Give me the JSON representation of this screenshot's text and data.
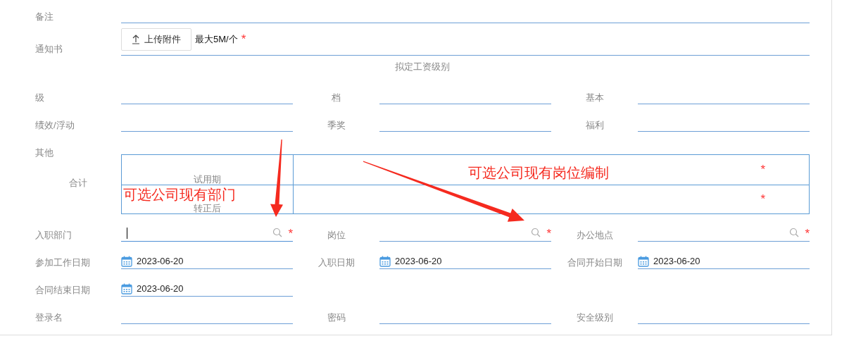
{
  "remark": {
    "label": "备注"
  },
  "notice": {
    "label": "通知书",
    "upload_button": "上传附件",
    "hint": "最大5M/个",
    "required_mark": "*"
  },
  "salary_section": {
    "title": "拟定工资级别",
    "rows": [
      [
        {
          "label": "级"
        },
        {
          "label": "档"
        },
        {
          "label": "基本"
        }
      ],
      [
        {
          "label": "绩效/浮动"
        },
        {
          "label": "季奖"
        },
        {
          "label": "福利"
        }
      ]
    ],
    "other_label": "其他"
  },
  "total": {
    "label": "合计",
    "rows": [
      {
        "label": "试用期",
        "required_mark": "*"
      },
      {
        "label": "转正后",
        "required_mark": "*"
      }
    ]
  },
  "field_rows": [
    [
      {
        "label": "入职部门",
        "kind": "search",
        "required_mark": "*",
        "focused": true
      },
      {
        "label": "岗位",
        "kind": "search",
        "required_mark": "*",
        "focused": false
      },
      {
        "label": "办公地点",
        "kind": "search",
        "required_mark": "*",
        "focused": false
      }
    ],
    [
      {
        "label": "参加工作日期",
        "kind": "date",
        "value": "2023-06-20"
      },
      {
        "label": "入职日期",
        "kind": "date",
        "value": "2023-06-20"
      },
      {
        "label": "合同开始日期",
        "kind": "date",
        "value": "2023-06-20"
      }
    ],
    [
      {
        "label": "合同结束日期",
        "kind": "date",
        "value": "2023-06-20"
      }
    ],
    [
      {
        "label": "登录名",
        "kind": "text"
      },
      {
        "label": "密码",
        "kind": "text"
      },
      {
        "label": "安全级别",
        "kind": "text"
      }
    ]
  ],
  "annotations": [
    {
      "text": "可选公司现有岗位编制"
    },
    {
      "text": "可选公司现有部门"
    }
  ]
}
